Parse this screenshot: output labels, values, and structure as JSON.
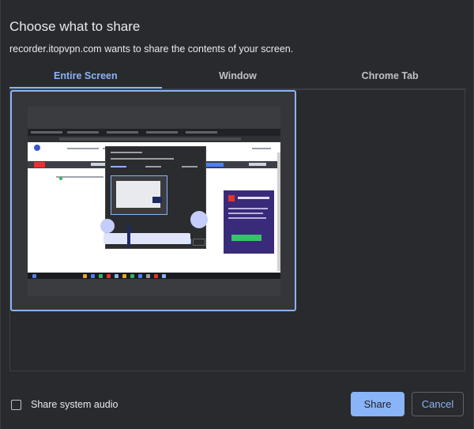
{
  "dialog": {
    "title": "Choose what to share",
    "subtitle": "recorder.itopvpn.com wants to share the contents of your screen."
  },
  "tabs": [
    {
      "label": "Entire Screen",
      "active": true
    },
    {
      "label": "Window",
      "active": false
    },
    {
      "label": "Chrome Tab",
      "active": false
    }
  ],
  "footer": {
    "audio_label": "Share system audio",
    "audio_checked": false,
    "share_label": "Share",
    "cancel_label": "Cancel"
  },
  "colors": {
    "accent": "#8ab4f8",
    "background": "#292a2d",
    "text": "#e8eaed"
  }
}
